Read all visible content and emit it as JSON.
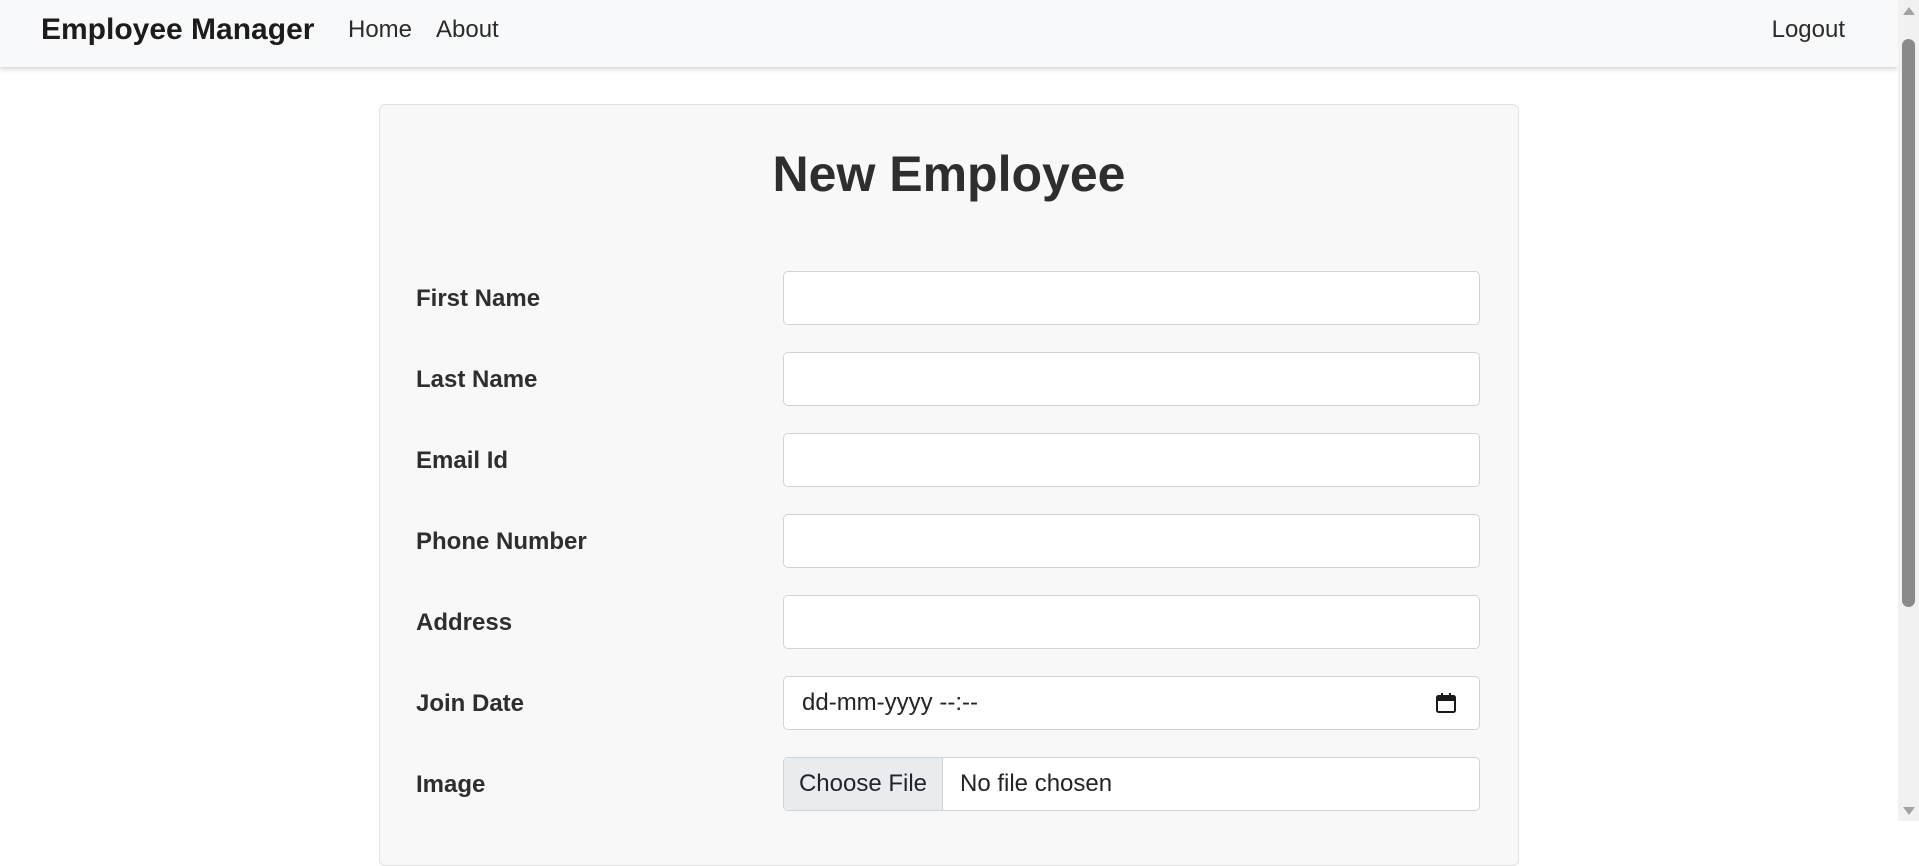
{
  "navbar": {
    "brand": "Employee Manager",
    "links": [
      "Home",
      "About"
    ],
    "logout": "Logout"
  },
  "form": {
    "title": "New Employee",
    "fields": [
      {
        "label": "First Name",
        "value": ""
      },
      {
        "label": "Last Name",
        "value": ""
      },
      {
        "label": "Email Id",
        "value": ""
      },
      {
        "label": "Phone Number",
        "value": ""
      },
      {
        "label": "Address",
        "value": ""
      },
      {
        "label": "Join Date",
        "placeholder": "dd-mm-yyyy --:--"
      },
      {
        "label": "Image",
        "button": "Choose File",
        "status": "No file chosen"
      }
    ]
  },
  "icons": {
    "date": "calendar-icon"
  }
}
